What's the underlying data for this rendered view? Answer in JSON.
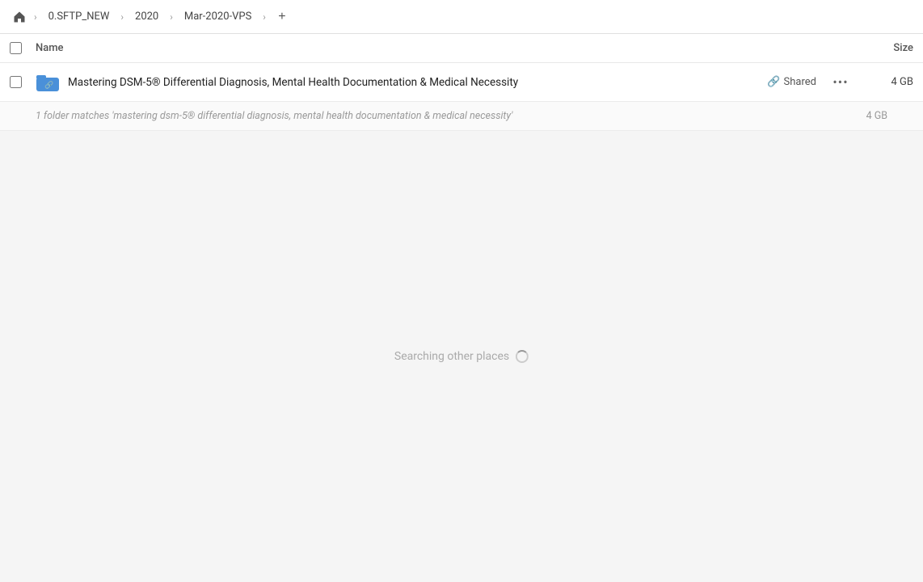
{
  "breadcrumb": {
    "home_label": "Home",
    "items": [
      {
        "label": "0.SFTP_NEW"
      },
      {
        "label": "2020"
      },
      {
        "label": "Mar-2020-VPS"
      }
    ],
    "add_label": "+"
  },
  "columns": {
    "name_label": "Name",
    "size_label": "Size"
  },
  "file_row": {
    "name": "Mastering DSM-5® Differential Diagnosis, Mental Health Documentation & Medical Necessity",
    "shared_label": "Shared",
    "size": "4 GB"
  },
  "match_info": {
    "text": "1 folder matches 'mastering dsm-5® differential diagnosis, mental health documentation & medical necessity'",
    "size": "4 GB"
  },
  "searching": {
    "label": "Searching other places"
  }
}
